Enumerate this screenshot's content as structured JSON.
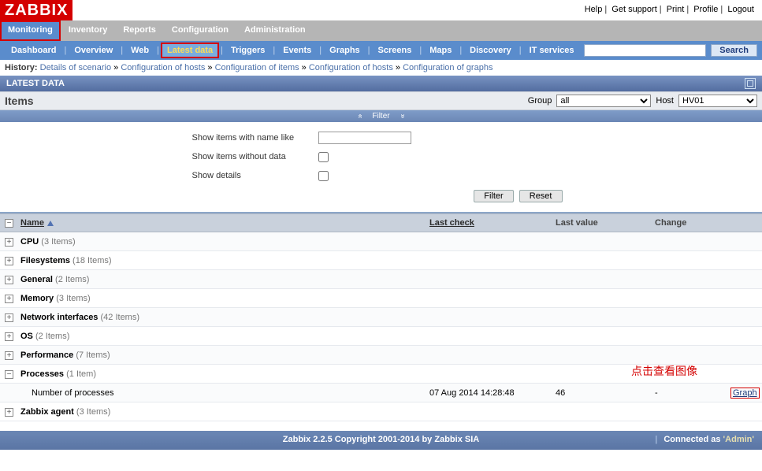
{
  "logo": "ZABBIX",
  "top_links": {
    "help": "Help",
    "support": "Get support",
    "print": "Print",
    "profile": "Profile",
    "logout": "Logout"
  },
  "main_tabs": [
    "Monitoring",
    "Inventory",
    "Reports",
    "Configuration",
    "Administration"
  ],
  "sub_tabs": [
    "Dashboard",
    "Overview",
    "Web",
    "Latest data",
    "Triggers",
    "Events",
    "Graphs",
    "Screens",
    "Maps",
    "Discovery",
    "IT services"
  ],
  "search_btn": "Search",
  "history": {
    "label": "History:",
    "items": [
      "Details of scenario",
      "Configuration of hosts",
      "Configuration of items",
      "Configuration of hosts",
      "Configuration of graphs"
    ]
  },
  "bar_title": "LATEST DATA",
  "items_title": "Items",
  "group": {
    "label": "Group",
    "value": "all"
  },
  "host": {
    "label": "Host",
    "value": "HV01"
  },
  "filter": {
    "title": "Filter",
    "name_like": "Show items with name like",
    "without_data": "Show items without data",
    "details": "Show details",
    "btn_filter": "Filter",
    "btn_reset": "Reset"
  },
  "cols": {
    "name": "Name",
    "check": "Last check",
    "val": "Last value",
    "chg": "Change"
  },
  "rows": [
    {
      "exp": "+",
      "name": "CPU",
      "count": "(3 Items)"
    },
    {
      "exp": "+",
      "name": "Filesystems",
      "count": "(18 Items)"
    },
    {
      "exp": "+",
      "name": "General",
      "count": "(2 Items)"
    },
    {
      "exp": "+",
      "name": "Memory",
      "count": "(3 Items)"
    },
    {
      "exp": "+",
      "name": "Network interfaces",
      "count": "(42 Items)"
    },
    {
      "exp": "+",
      "name": "OS",
      "count": "(2 Items)"
    },
    {
      "exp": "+",
      "name": "Performance",
      "count": "(7 Items)"
    },
    {
      "exp": "−",
      "name": "Processes",
      "count": "(1 Item)",
      "annotation": "点击查看图像"
    },
    {
      "leaf": true,
      "name": "Number of processes",
      "check": "07 Aug 2014 14:28:48",
      "val": "46",
      "chg": "-",
      "act": "Graph"
    },
    {
      "exp": "+",
      "name": "Zabbix agent",
      "count": "(3 Items)"
    }
  ],
  "footer": {
    "copy": "Zabbix 2.2.5 Copyright 2001-2014 by Zabbix SIA",
    "connected": "Connected as ",
    "user": "'Admin'"
  }
}
